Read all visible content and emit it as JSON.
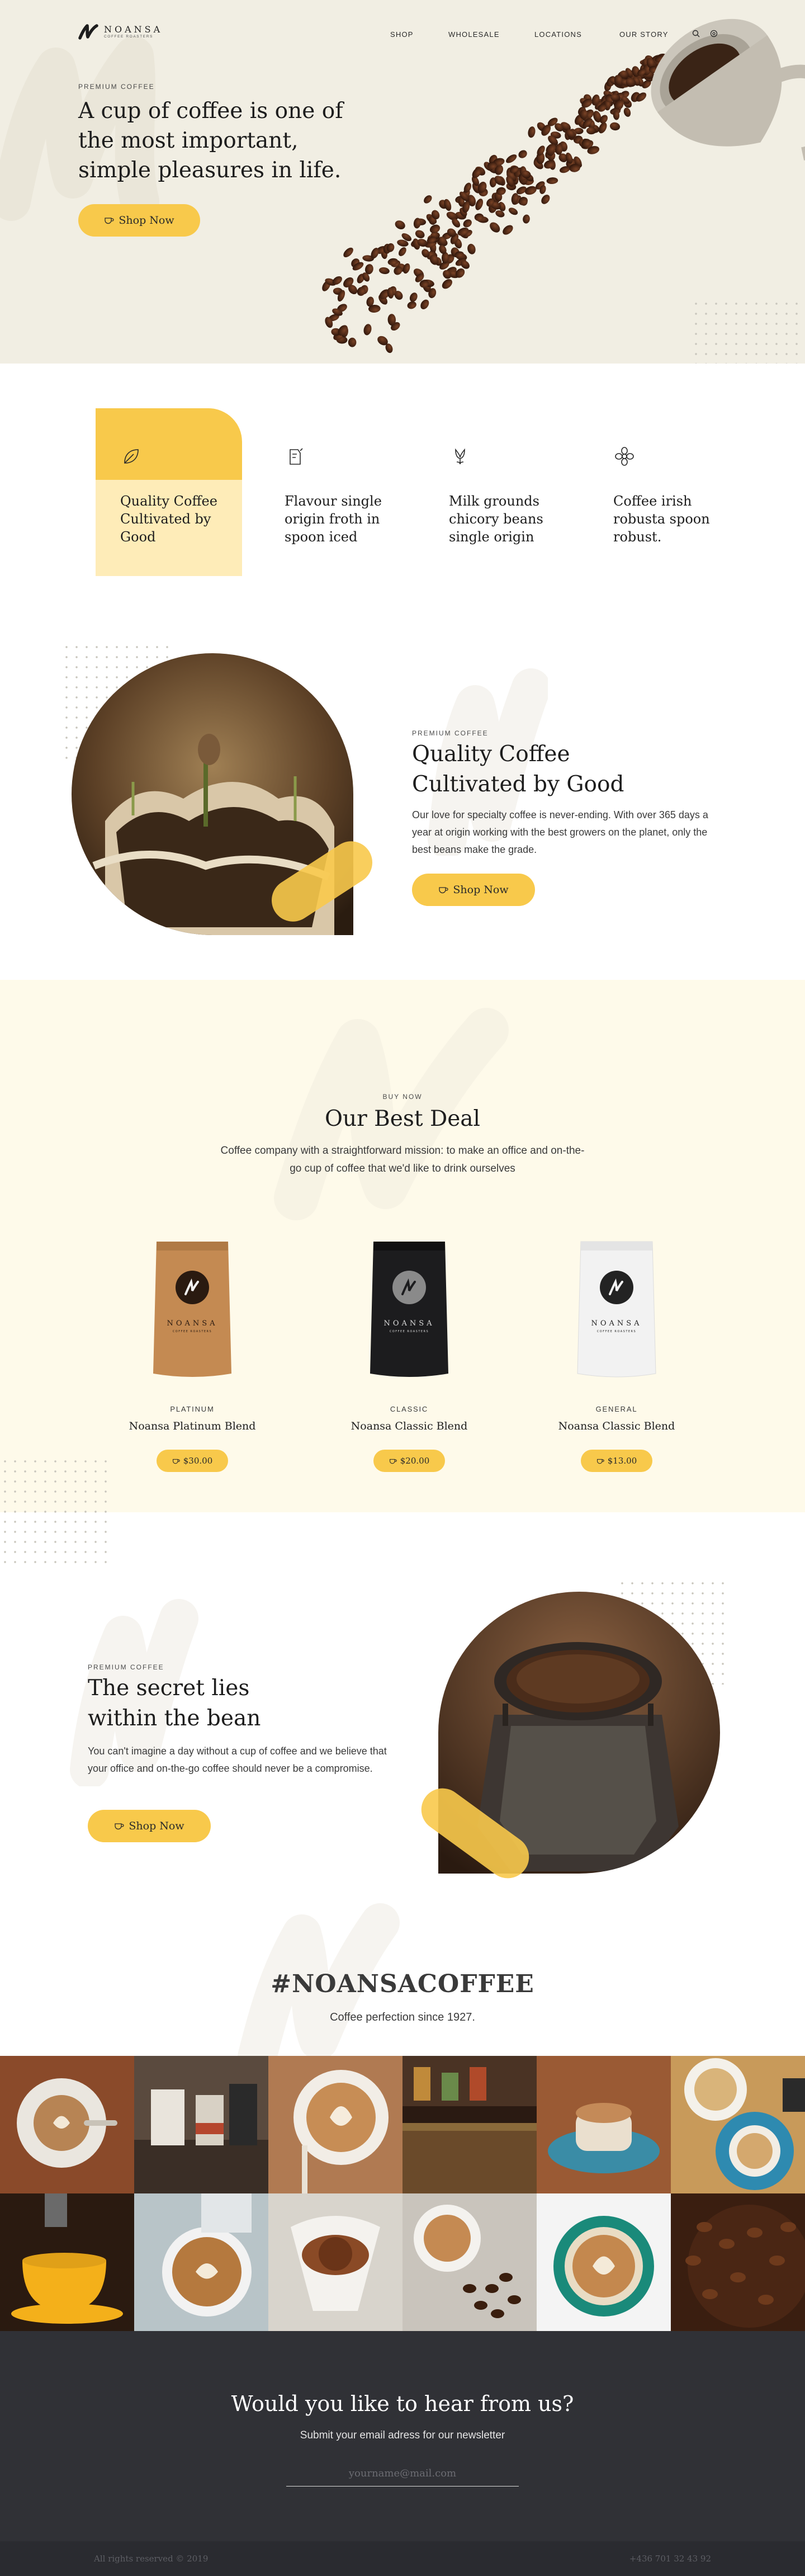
{
  "brand": {
    "name": "NOANSA",
    "tagline": "COFFEE ROASTERS"
  },
  "nav": {
    "items": [
      {
        "label": "SHOP"
      },
      {
        "label": "WHOLESALE"
      },
      {
        "label": "LOCATIONS"
      },
      {
        "label": "OUR STORY"
      }
    ],
    "icons": [
      "search-icon",
      "cart-icon"
    ]
  },
  "hero": {
    "kicker": "PREMIUM COFFEE",
    "title": "A cup of coffee is one of the most important, simple pleasures in life.",
    "button": "Shop Now"
  },
  "features": [
    {
      "icon": "leaf-icon",
      "text": "Quality Coffee Cultivated by Good"
    },
    {
      "icon": "cup-sketch-icon",
      "text": "Flavour single origin froth in spoon iced"
    },
    {
      "icon": "flower-bud-icon",
      "text": "Milk grounds chicory beans single origin"
    },
    {
      "icon": "flower-icon",
      "text": "Coffee irish robusta spoon robust."
    }
  ],
  "quality": {
    "kicker": "PREMIUM COFFEE",
    "title": "Quality Coffee Cultivated by Good",
    "body": "Our love for specialty coffee is never-ending. With over 365 days a year at origin working with the best growers on the planet, only the best beans make the grade.",
    "button": "Shop Now"
  },
  "deal": {
    "kicker": "BUY NOW",
    "title": "Our Best Deal",
    "subtitle": "Coffee company with a straightforward mission: to make an office and on-the-go cup of coffee that we'd like to drink ourselves",
    "products": [
      {
        "tier": "PLATINUM",
        "name": "Noansa Platinum Blend",
        "price": "$30.00",
        "bag_color": "#c48a52"
      },
      {
        "tier": "CLASSIC",
        "name": "Noansa Classic Blend",
        "price": "$20.00",
        "bag_color": "#1c1c1e"
      },
      {
        "tier": "GENERAL",
        "name": "Noansa Classic Blend",
        "price": "$13.00",
        "bag_color": "#f2f2f2"
      }
    ]
  },
  "secret": {
    "kicker": "PREMIUM COFFEE",
    "title": "The secret lies within the bean",
    "body": "You can't imagine a day without a cup of coffee and we believe that your office and on-the-go coffee should never be a compromise.",
    "button": "Shop Now"
  },
  "hashtag": {
    "title": "#NOANSACOFFEE",
    "subtitle": "Coffee perfection since 1927."
  },
  "newsletter": {
    "title": "Would you like to hear from us?",
    "subtitle": "Submit your email adress for our newsletter",
    "placeholder": "yourname@mail.com"
  },
  "footer": {
    "copyright": "All rights reserved © 2019",
    "phone": "+436 701 32 43 92"
  },
  "colors": {
    "accent": "#f8c94b",
    "accent_light": "#feecb8",
    "hero_bg": "#f1eee3",
    "deal_bg": "#fefaea",
    "dark": "#303136"
  }
}
